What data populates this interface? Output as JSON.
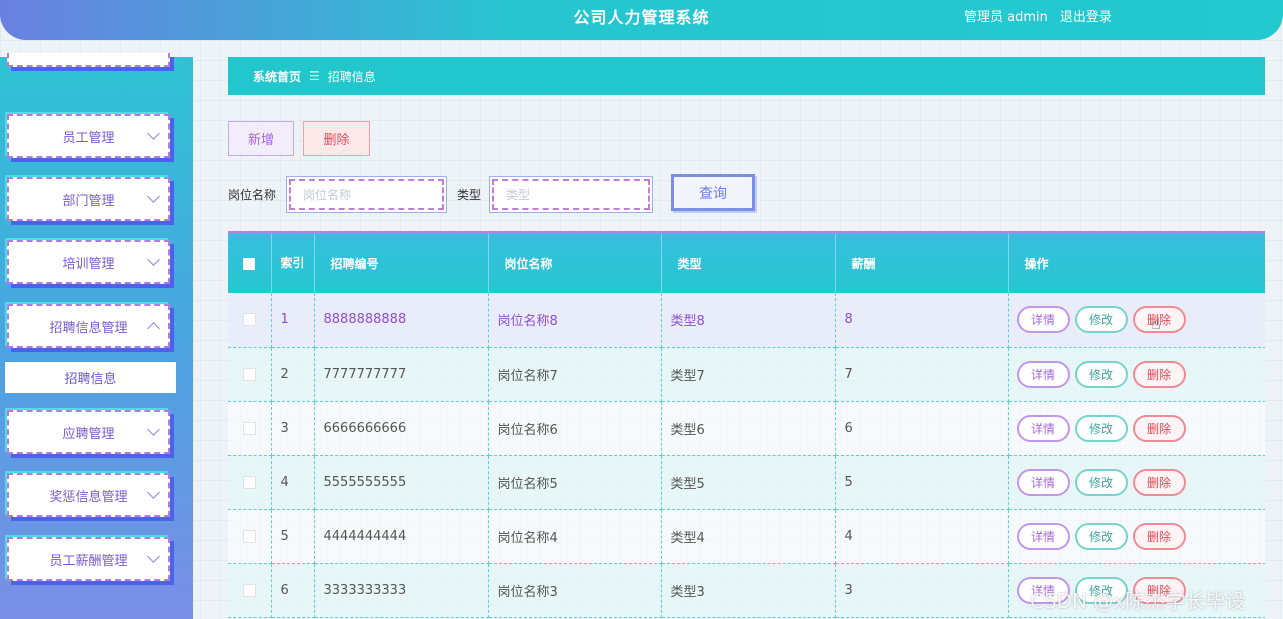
{
  "header": {
    "title": "公司人力管理系统",
    "user_label": "管理员 admin",
    "logout_label": "退出登录"
  },
  "sidebar": {
    "items": [
      {
        "label": "员工管理",
        "expanded": false
      },
      {
        "label": "部门管理",
        "expanded": false
      },
      {
        "label": "培训管理",
        "expanded": false
      },
      {
        "label": "招聘信息管理",
        "expanded": true
      },
      {
        "label": "应聘管理",
        "expanded": false
      },
      {
        "label": "奖惩信息管理",
        "expanded": false
      },
      {
        "label": "员工薪酬管理",
        "expanded": false
      }
    ],
    "active_sub": "招聘信息"
  },
  "breadcrumb": {
    "home": "系统首页",
    "separator": "☰",
    "current": "招聘信息"
  },
  "actions": {
    "add_label": "新增",
    "delete_label": "删除"
  },
  "search": {
    "name_label": "岗位名称",
    "name_placeholder": "岗位名称",
    "type_label": "类型",
    "type_placeholder": "类型",
    "button_label": "查询"
  },
  "table": {
    "headers": {
      "index": "索引",
      "code": "招聘编号",
      "position": "岗位名称",
      "type": "类型",
      "salary": "薪酬",
      "ops": "操作"
    },
    "op_labels": {
      "detail": "详情",
      "edit": "修改",
      "delete": "删除"
    },
    "rows": [
      {
        "index": "1",
        "code": "8888888888",
        "position": "岗位名称8",
        "type": "类型8",
        "salary": "8"
      },
      {
        "index": "2",
        "code": "7777777777",
        "position": "岗位名称7",
        "type": "类型7",
        "salary": "7"
      },
      {
        "index": "3",
        "code": "6666666666",
        "position": "岗位名称6",
        "type": "类型6",
        "salary": "6"
      },
      {
        "index": "4",
        "code": "5555555555",
        "position": "岗位名称5",
        "type": "类型5",
        "salary": "5"
      },
      {
        "index": "5",
        "code": "4444444444",
        "position": "岗位名称4",
        "type": "类型4",
        "salary": "4"
      },
      {
        "index": "6",
        "code": "3333333333",
        "position": "岗位名称3",
        "type": "类型3",
        "salary": "3"
      }
    ]
  },
  "watermark": "CSDN @x陈杰学长毕设",
  "colors": {
    "accent": "#21c7cc",
    "primary_purple": "#b37de0",
    "danger": "#e04a58"
  }
}
